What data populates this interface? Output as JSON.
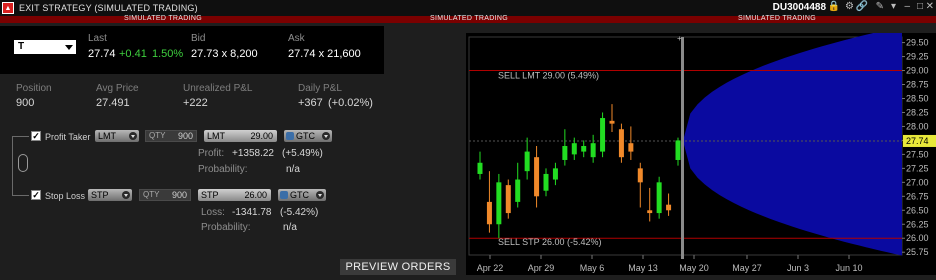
{
  "window": {
    "title": "EXIT STRATEGY (SIMULATED TRADING)",
    "account": "DU3004488",
    "sim_banner": "SIMULATED TRADING"
  },
  "quote": {
    "symbol": "T",
    "last_label": "Last",
    "last": "27.74",
    "change": "+0.41",
    "change_pct": "1.50%",
    "bid_label": "Bid",
    "bid": "27.73 x 8,200",
    "ask_label": "Ask",
    "ask": "27.74 x 21,600"
  },
  "position": {
    "position_label": "Position",
    "position": "900",
    "avg_price_label": "Avg Price",
    "avg_price": "27.491",
    "unrealized_label": "Unrealized P&L",
    "unrealized": "+222",
    "daily_label": "Daily P&L",
    "daily": "+367",
    "daily_pct": "(+0.02%)"
  },
  "profit_taker": {
    "label": "Profit Taker",
    "order_type": "LMT",
    "qty_label": "QTY",
    "qty": "900",
    "price_type": "LMT",
    "price": "29.00",
    "tif": "GTC",
    "result_label": "Profit:",
    "result": "+1358.22",
    "result_pct": "(+5.49%)",
    "prob_label": "Probability:",
    "prob": "n/a"
  },
  "stop_loss": {
    "label": "Stop Loss",
    "order_type": "STP",
    "qty_label": "QTY",
    "qty": "900",
    "price_type": "STP",
    "price": "26.00",
    "tif": "GTC",
    "result_label": "Loss:",
    "result": "-1341.78",
    "result_pct": "(-5.42%)",
    "prob_label": "Probability:",
    "prob": "n/a"
  },
  "preview_button": "PREVIEW ORDERS",
  "colors": {
    "up": "#22dd22",
    "down": "#f0892a",
    "cone": "#0a0aa0",
    "level_line": "#b00000",
    "last_tag": "#e8e83a"
  },
  "chart_data": {
    "type": "candlestick",
    "ylim": [
      25.7,
      29.6
    ],
    "y_ticks": [
      "29.50",
      "29.25",
      "29.00",
      "28.75",
      "28.50",
      "28.25",
      "28.00",
      "27.75",
      "27.50",
      "27.25",
      "27.00",
      "26.75",
      "26.50",
      "26.25",
      "26.00",
      "25.75"
    ],
    "x_ticks": [
      "Apr 22",
      "Apr 29",
      "May 6",
      "May 13",
      "May 20",
      "May 27",
      "Jun 3",
      "Jun 10"
    ],
    "last_price": "27.74",
    "levels": [
      {
        "label": "SELL LMT 29.00 (5.49%)",
        "value": 29.0
      },
      {
        "label": "SELL STP 26.00 (-5.42%)",
        "value": 26.0
      }
    ],
    "candles": [
      {
        "o": 27.15,
        "c": 27.35,
        "h": 27.55,
        "l": 27.05
      },
      {
        "o": 26.65,
        "c": 26.25,
        "h": 27.2,
        "l": 26.1
      },
      {
        "o": 26.25,
        "c": 27.0,
        "h": 27.15,
        "l": 26.0
      },
      {
        "o": 26.95,
        "c": 26.45,
        "h": 27.05,
        "l": 26.35
      },
      {
        "o": 26.65,
        "c": 27.05,
        "h": 27.35,
        "l": 26.55
      },
      {
        "o": 27.2,
        "c": 27.55,
        "h": 27.8,
        "l": 27.05
      },
      {
        "o": 27.45,
        "c": 26.75,
        "h": 27.65,
        "l": 26.55
      },
      {
        "o": 26.85,
        "c": 27.15,
        "h": 27.25,
        "l": 26.75
      },
      {
        "o": 27.05,
        "c": 27.25,
        "h": 27.35,
        "l": 26.95
      },
      {
        "o": 27.4,
        "c": 27.65,
        "h": 27.95,
        "l": 27.3
      },
      {
        "o": 27.5,
        "c": 27.7,
        "h": 27.8,
        "l": 27.4
      },
      {
        "o": 27.55,
        "c": 27.65,
        "h": 27.75,
        "l": 27.45
      },
      {
        "o": 27.45,
        "c": 27.7,
        "h": 27.85,
        "l": 27.35
      },
      {
        "o": 27.55,
        "c": 28.15,
        "h": 28.25,
        "l": 27.45
      },
      {
        "o": 28.1,
        "c": 28.05,
        "h": 28.4,
        "l": 27.9
      },
      {
        "o": 27.95,
        "c": 27.45,
        "h": 28.05,
        "l": 27.35
      },
      {
        "o": 27.7,
        "c": 27.55,
        "h": 28.0,
        "l": 27.4
      },
      {
        "o": 27.25,
        "c": 27.0,
        "h": 27.35,
        "l": 26.55
      },
      {
        "o": 26.5,
        "c": 26.45,
        "h": 26.9,
        "l": 26.3
      },
      {
        "o": 26.45,
        "c": 27.0,
        "h": 27.1,
        "l": 26.35
      },
      {
        "o": 26.6,
        "c": 26.5,
        "h": 26.8,
        "l": 26.4
      },
      {
        "o": 27.4,
        "c": 27.75,
        "h": 27.8,
        "l": 27.3
      }
    ]
  }
}
